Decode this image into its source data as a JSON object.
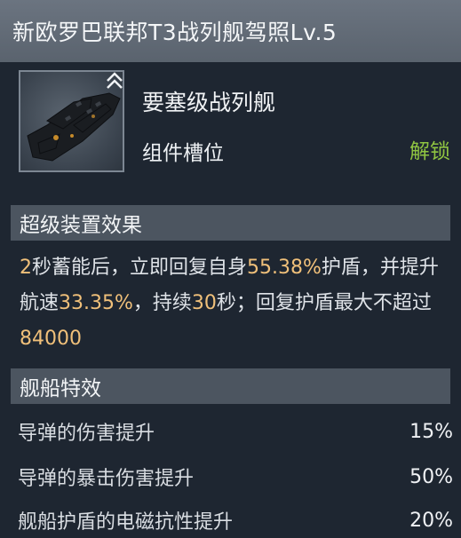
{
  "header": {
    "title": "新欧罗巴联邦T3战列舰驾照Lv.5"
  },
  "ship": {
    "class_name": "要塞级战列舰",
    "slot_label": "组件槽位",
    "unlock_label": "解锁"
  },
  "super_device": {
    "title": "超级装置效果",
    "desc": [
      {
        "text": "2",
        "hl": true
      },
      {
        "text": "秒蓄能后，立即回复自身",
        "hl": false
      },
      {
        "text": "55.38%",
        "hl": true
      },
      {
        "text": "护盾，并提升航速",
        "hl": false
      },
      {
        "text": "33.35%",
        "hl": true
      },
      {
        "text": "，持续",
        "hl": false
      },
      {
        "text": "30",
        "hl": true
      },
      {
        "text": "秒；回复护盾最大不超过",
        "hl": false
      },
      {
        "text": "84000",
        "hl": true
      }
    ]
  },
  "ship_effects": {
    "title": "舰船特效",
    "rows": [
      {
        "label": "导弹的伤害提升",
        "value": "15%"
      },
      {
        "label": "导弹的暴击伤害提升",
        "value": "50%"
      },
      {
        "label": "舰船护盾的电磁抗性提升",
        "value": "20%"
      }
    ]
  },
  "colors": {
    "highlight": "#f0c07a",
    "unlock": "#8fc441",
    "background": "#1e2631"
  },
  "icons": {
    "ship_thumbnail": "battleship-image",
    "rank": "rank-chevron-icon"
  }
}
